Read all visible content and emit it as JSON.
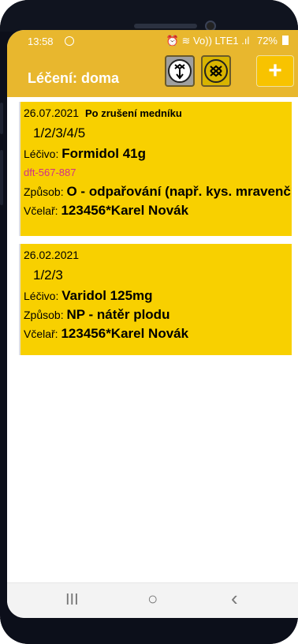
{
  "status": {
    "time": "13:58",
    "right_icons": "⏰ ≋ Vo)) LTE1 .ıl",
    "battery": "72%"
  },
  "app": {
    "title": "Léčení: doma",
    "add_label": "+"
  },
  "treatments": [
    {
      "date": "26.07.2021",
      "note": "Po zrušení medníku",
      "ids": "1/2/3/4/5",
      "medicine_label": "Léčivo: ",
      "medicine": "Formidol 41g",
      "code": "dft-567-887",
      "method_label": "Způsob: ",
      "method": "O - odpařování (např. kys. mravenčí)",
      "beekeeper_label": "Včelař: ",
      "beekeeper": "123456*Karel Novák"
    },
    {
      "date": "26.02.2021",
      "note": "",
      "ids": "1/2/3",
      "medicine_label": "Léčivo: ",
      "medicine": "Varidol 125mg",
      "code": "",
      "method_label": "Způsob: ",
      "method": "NP - nátěr plodu",
      "beekeeper_label": "Včelař: ",
      "beekeeper": "123456*Karel Novák"
    }
  ],
  "nav": {
    "recent": "III",
    "home": "○",
    "back": "‹"
  },
  "colors": {
    "appbar": "#e8b72e",
    "card": "#f8d000",
    "code": "#d0318a"
  }
}
